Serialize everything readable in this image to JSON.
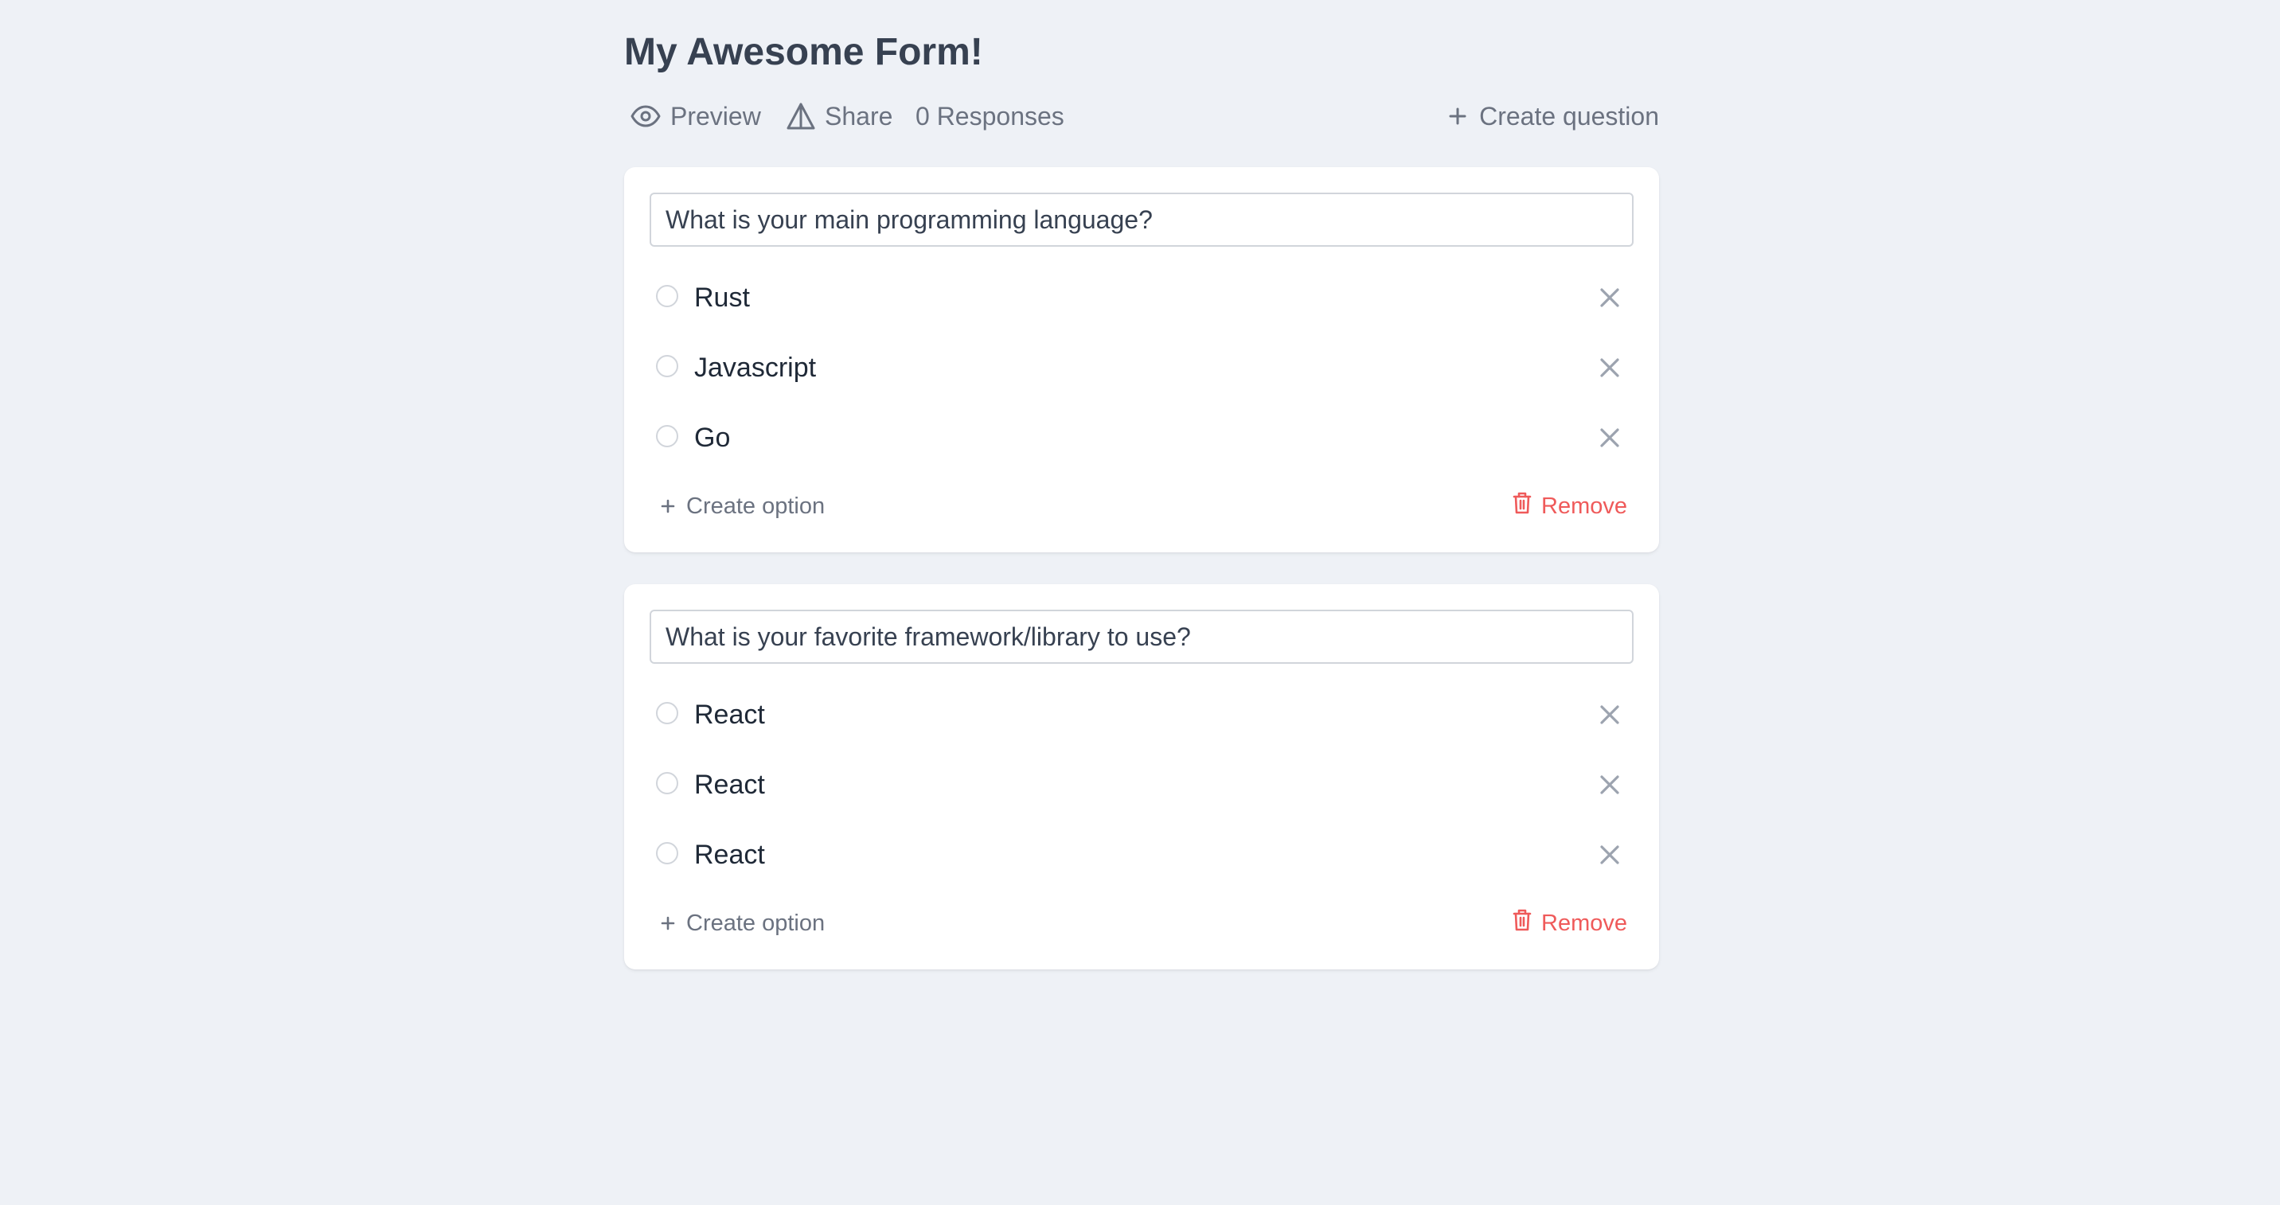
{
  "form": {
    "title": "My Awesome Form!"
  },
  "toolbar": {
    "preview_label": "Preview",
    "share_label": "Share",
    "responses_label": "0 Responses",
    "create_question_label": "Create question"
  },
  "questions": [
    {
      "question": "What is your main programming language?",
      "options": [
        "Rust",
        "Javascript",
        "Go"
      ],
      "create_option_label": "Create option",
      "remove_label": "Remove"
    },
    {
      "question": "What is your favorite framework/library to use?",
      "options": [
        "React",
        "React",
        "React"
      ],
      "create_option_label": "Create option",
      "remove_label": "Remove"
    }
  ],
  "icons": {
    "preview": "eye-icon",
    "share": "share-triangle-icon",
    "create_question": "plus-icon",
    "option_remove": "close-icon",
    "create_option": "plus-icon",
    "remove": "trash-icon"
  },
  "colors": {
    "background": "#eef1f6",
    "card": "#ffffff",
    "text": "#374151",
    "muted": "#6b7280",
    "danger": "#ef5a5a"
  }
}
